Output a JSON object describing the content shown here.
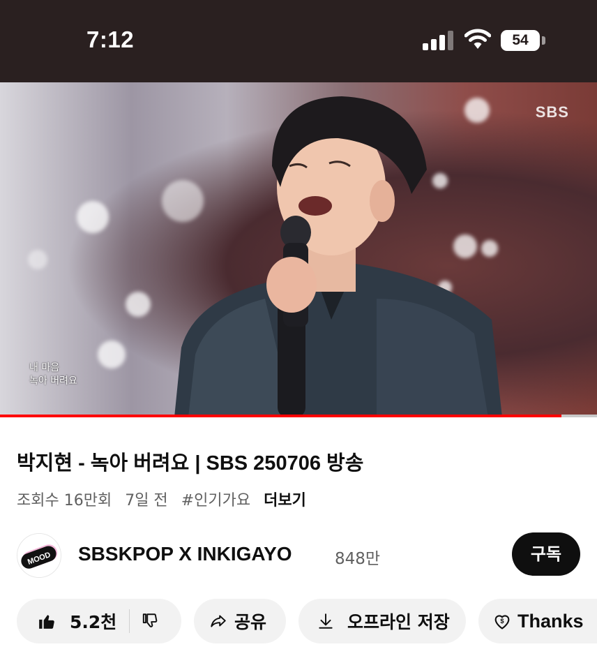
{
  "status_bar": {
    "time": "7:12",
    "battery": "54",
    "icons": [
      "signal-icon",
      "wifi-icon",
      "battery-icon"
    ]
  },
  "video": {
    "watermark": "SBS",
    "caption_line1": "내 마음",
    "caption_line2": "녹아 버려요",
    "progress": 0.94,
    "progress_color": "#ff0000"
  },
  "info": {
    "title": "박지현 - 녹아 버려요 | SBS 250706 방송",
    "views": "조회수 16만회",
    "age": "7일 전",
    "hashtag": "#인기가요",
    "more": "더보기"
  },
  "channel": {
    "name": "SBSKPOP X INKIGAYO",
    "subscribers": "848만",
    "subscribe_label": "구독",
    "avatar_text": "MOOD"
  },
  "actions": {
    "like_count": "5.2천",
    "share_label": "공유",
    "download_label": "오프라인 저장",
    "thanks_label": "Thanks"
  },
  "colors": {
    "status_bar_bg": "#2a2020",
    "subscribe_bg": "#0f0f0f",
    "pill_bg": "#f2f2f2"
  }
}
